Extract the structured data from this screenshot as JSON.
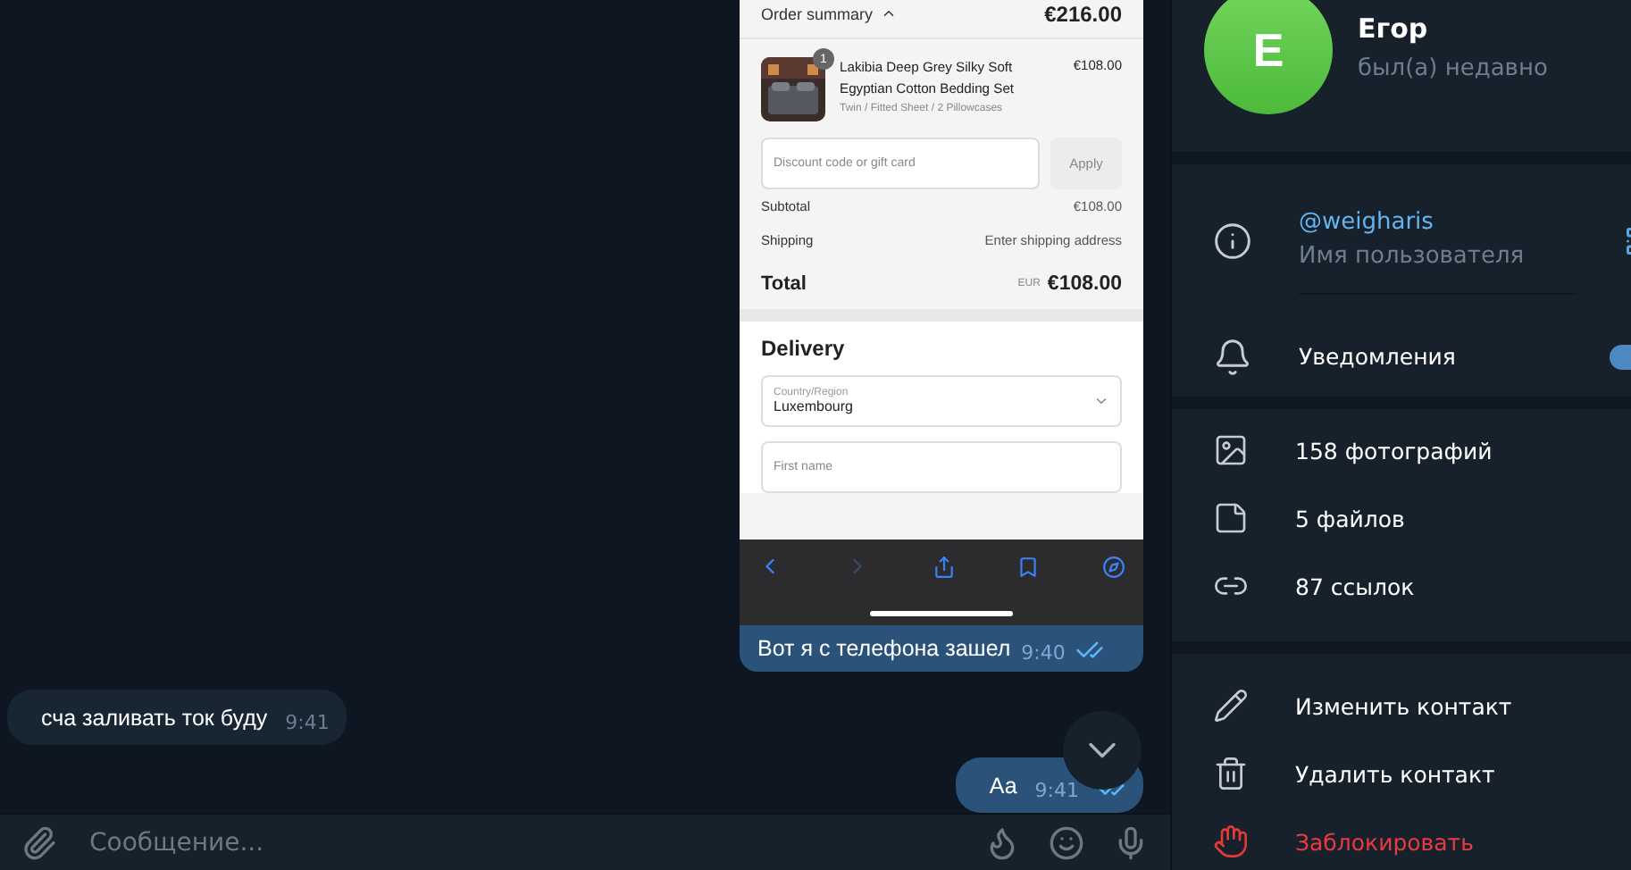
{
  "chat": {
    "shared_page": {
      "order_summary_label": "Order summary",
      "order_total": "€216.00",
      "product": {
        "badge": "1",
        "name": "Lakibia Deep Grey Silky Soft Egyptian Cotton Bedding Set",
        "variant": "Twin / Fitted Sheet / 2 Pillowcases",
        "price": "€108.00"
      },
      "discount": {
        "placeholder": "Discount code or gift card",
        "button": "Apply"
      },
      "rows": [
        {
          "label": "Subtotal",
          "value": "€108.00"
        },
        {
          "label": "Shipping",
          "value": "Enter shipping address"
        }
      ],
      "total": {
        "label": "Total",
        "currency": "EUR",
        "value": "€108.00"
      },
      "delivery": {
        "heading": "Delivery",
        "country_label": "Country/Region",
        "country_value": "Luxembourg",
        "first_name_placeholder": "First name"
      }
    },
    "messages": [
      {
        "kind": "screenshot",
        "outgoing": true,
        "text": "Вот я с телефона зашел",
        "time": "9:40",
        "read": true
      },
      {
        "kind": "text",
        "outgoing": false,
        "text": "сча заливать ток буду",
        "time": "9:41"
      },
      {
        "kind": "text",
        "outgoing": true,
        "text": "Аа",
        "time": "9:41",
        "read": true
      }
    ],
    "composer": {
      "placeholder": "Сообщение..."
    }
  },
  "profile": {
    "avatar_letter": "E",
    "name": "Егор",
    "status": "был(а) недавно",
    "username": {
      "value": "@weigharis",
      "label": "Имя пользователя"
    },
    "notifications": {
      "label": "Уведомления",
      "on": true
    },
    "media": [
      {
        "kind": "photos",
        "text": "158 фотографий"
      },
      {
        "kind": "files",
        "text": "5 файлов"
      },
      {
        "kind": "links",
        "text": "87 ссылок"
      }
    ],
    "actions": [
      {
        "kind": "edit",
        "text": "Изменить контакт",
        "danger": false
      },
      {
        "kind": "delete",
        "text": "Удалить контакт",
        "danger": false
      },
      {
        "kind": "block",
        "text": "Заблокировать",
        "danger": true
      }
    ]
  }
}
